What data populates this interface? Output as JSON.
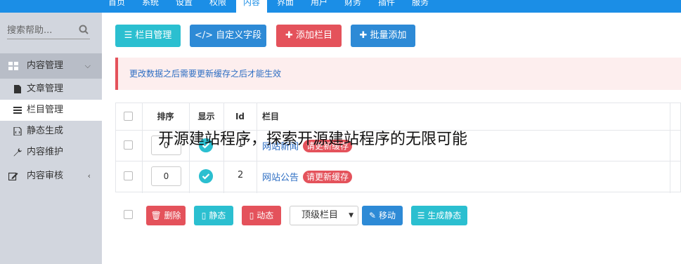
{
  "topnav": {
    "items": [
      "首页",
      "系统",
      "设置",
      "权限",
      "内容",
      "界面",
      "用户",
      "财务",
      "插件",
      "服务"
    ],
    "active_index": 4
  },
  "sidebar": {
    "search_placeholder": "搜索帮助...",
    "group_label": "内容管理",
    "items": [
      "文章管理",
      "栏目管理",
      "静态生成",
      "内容维护"
    ],
    "active_item": "栏目管理",
    "review_label": "内容审核"
  },
  "toolbar": {
    "column_manage": "栏目管理",
    "custom_fields": "自定义字段",
    "add_column": "添加栏目",
    "batch_add": "批量添加"
  },
  "notice": "更改数据之后需要更新缓存之后才能生效",
  "table": {
    "headers": [
      "排序",
      "显示",
      "Id",
      "栏目"
    ],
    "rows": [
      {
        "order": "0",
        "visible": true,
        "id": "1",
        "name": "网站新闻",
        "badge": "请更新缓存"
      },
      {
        "order": "0",
        "visible": true,
        "id": "2",
        "name": "网站公告",
        "badge": "请更新缓存"
      }
    ]
  },
  "bulk_actions": {
    "delete": "删除",
    "static": "静态",
    "dynamic": "动态",
    "parent_select": "顶级栏目",
    "move": "移动",
    "generate_static": "生成静态"
  },
  "watermark": "开源建站程序，探索开源建站程序的无限可能",
  "colors": {
    "primary": "#1b8ee6",
    "teal": "#2bbfd0",
    "blue": "#2d8ad6",
    "red": "#e4525b",
    "sidebar": "#d2d6de"
  }
}
